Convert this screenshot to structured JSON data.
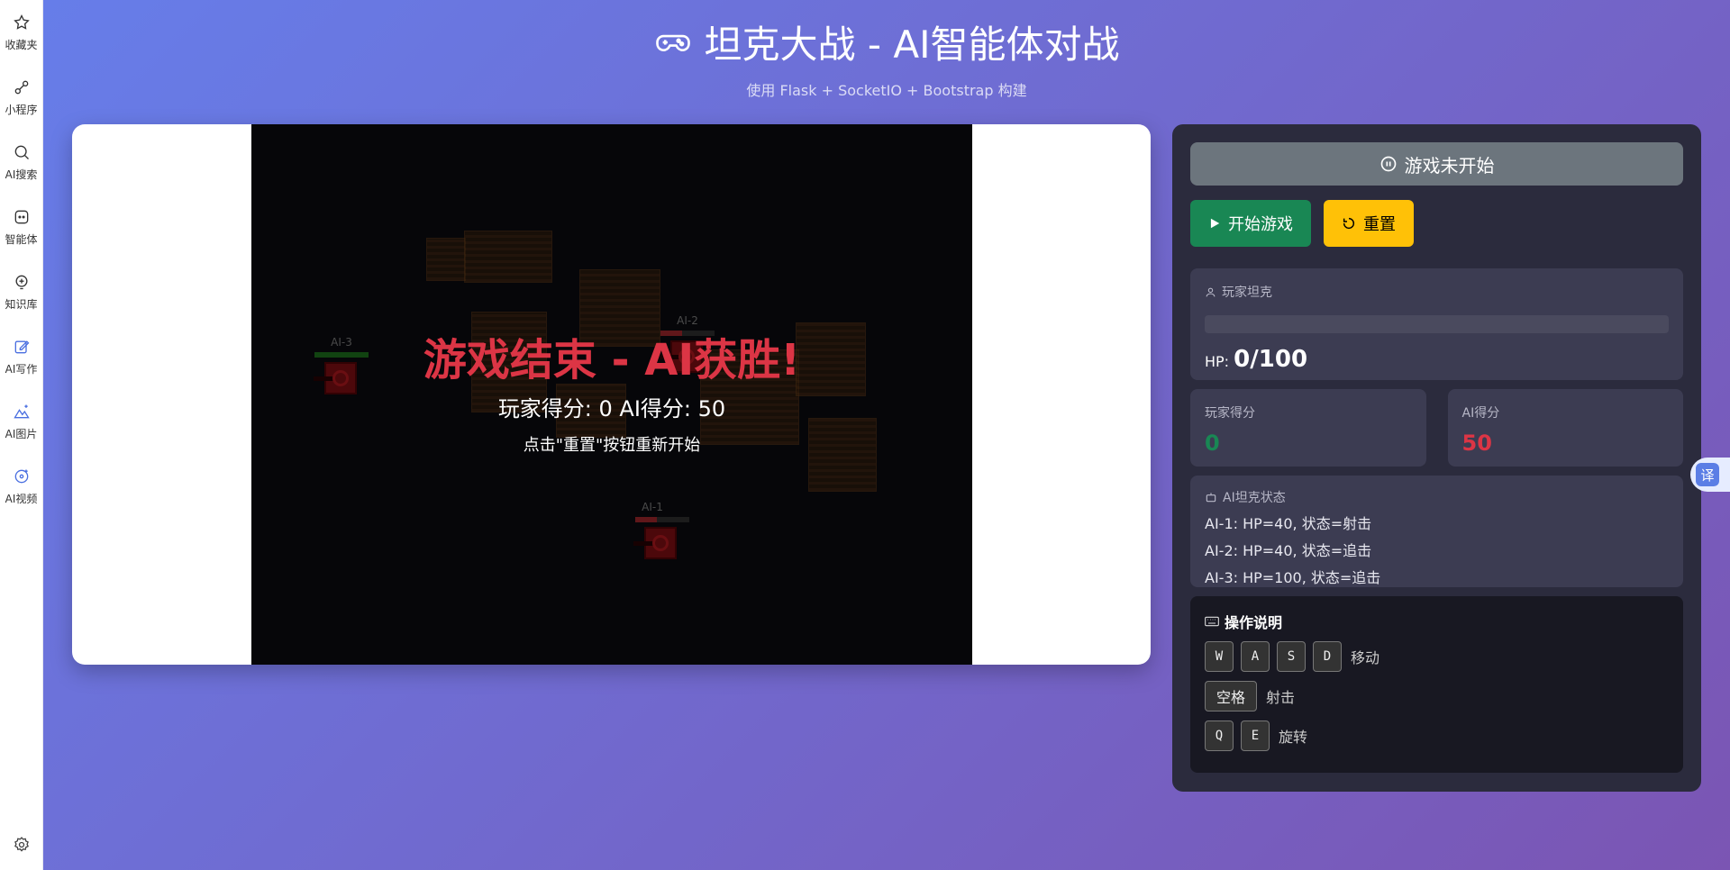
{
  "sidebar": {
    "items": [
      {
        "label": "收藏夹",
        "icon": "star-icon"
      },
      {
        "label": "小程序",
        "icon": "link-icon"
      },
      {
        "label": "AI搜索",
        "icon": "search-icon"
      },
      {
        "label": "智能体",
        "icon": "agent-icon"
      },
      {
        "label": "知识库",
        "icon": "knowledge-icon"
      },
      {
        "label": "AI写作",
        "icon": "write-icon"
      },
      {
        "label": "AI图片",
        "icon": "image-icon"
      },
      {
        "label": "AI视频",
        "icon": "video-icon"
      }
    ],
    "settings_icon": "gear-icon"
  },
  "header": {
    "title": "坦克大战 - AI智能体对战",
    "subtitle": "使用 Flask + SocketIO + Bootstrap 构建",
    "title_icon": "gamepad-icon"
  },
  "game": {
    "overlay_title": "游戏结束 - AI获胜!",
    "overlay_scores": "玩家得分: 0  AI得分: 50",
    "overlay_hint": "点击\"重置\"按钮重新开始",
    "tanks": [
      {
        "label": "AI-3",
        "hp_fraction": 1.0,
        "hp_color": "#1f7a1f"
      },
      {
        "label": "AI-2",
        "hp_fraction": 0.4,
        "hp_color": "#b02a30"
      },
      {
        "label": "AI-1",
        "hp_fraction": 0.4,
        "hp_color": "#b02a30"
      }
    ]
  },
  "panel": {
    "status_label": "游戏未开始",
    "start_label": "开始游戏",
    "reset_label": "重置",
    "player": {
      "label": "玩家坦克",
      "hp_prefix": "HP:",
      "hp_value": "0/100",
      "hp_fraction": 0
    },
    "player_score": {
      "label": "玩家得分",
      "value": "0",
      "color": "#198754"
    },
    "ai_score": {
      "label": "AI得分",
      "value": "50",
      "color": "#dc3545"
    },
    "ai_status": {
      "label": "AI坦克状态",
      "lines": [
        "AI-1: HP=40, 状态=射击",
        "AI-2: HP=40, 状态=追击",
        "AI-3: HP=100, 状态=追击"
      ]
    },
    "help": {
      "title": "操作说明",
      "move_keys": [
        "W",
        "A",
        "S",
        "D"
      ],
      "move_desc": "移动",
      "fire_key": "空格",
      "fire_desc": "射击",
      "rotate_keys": [
        "Q",
        "E"
      ],
      "rotate_desc": "旋转"
    }
  },
  "translate_label": "译"
}
